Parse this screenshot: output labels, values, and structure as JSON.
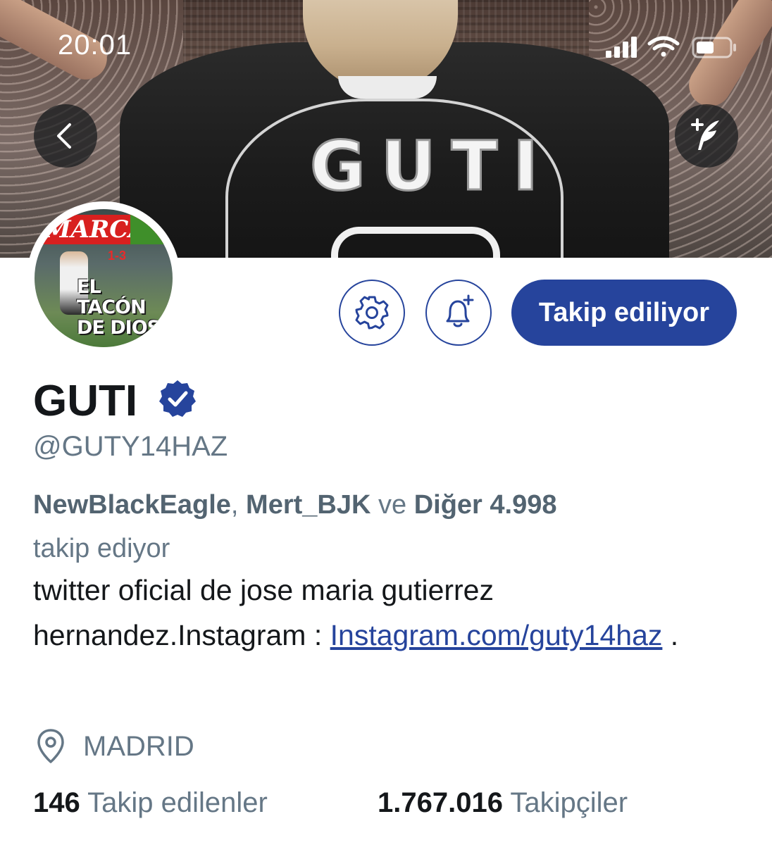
{
  "status_bar": {
    "time": "20:01",
    "icons": [
      "signal-icon",
      "wifi-icon",
      "battery-icon"
    ]
  },
  "header": {
    "back_icon": "chevron-left-icon",
    "compose_icon": "compose-tweet-icon",
    "banner": {
      "jersey_name": "GUTI"
    }
  },
  "avatar": {
    "masthead": "MARCA",
    "score": "1-3",
    "headline": "EL TACÓN DE DIOS"
  },
  "actions": {
    "settings_icon": "gear-icon",
    "notifications_icon": "bell-plus-icon",
    "follow_label": "Takip ediliyor"
  },
  "profile": {
    "name": "GUTI",
    "verified": true,
    "handle": "@GUTY14HAZ",
    "followed_by": {
      "user1": "NewBlackEagle",
      "sep": ", ",
      "user2": "Mert_BJK",
      "connector": " ve ",
      "others": "Diğer 4.998",
      "suffix": "takip ediyor"
    },
    "bio": {
      "text": "twitter oficial de jose maria gutierrez hernandez.Instagram : ",
      "link": "Instagram.com/guty14haz",
      "trailing": " ."
    },
    "location": "MADRID",
    "following_count": "146",
    "following_label": "Takip edilenler",
    "followers_count": "1.767.016",
    "followers_label": "Takipçiler"
  },
  "colors": {
    "accent": "#26449c",
    "text_primary": "#14171a",
    "text_secondary": "#657786"
  }
}
